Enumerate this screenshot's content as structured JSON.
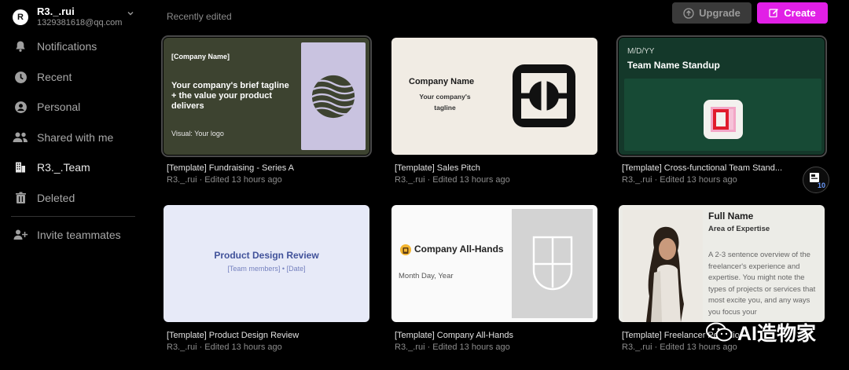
{
  "account": {
    "initial": "R",
    "name": "R3._.rui",
    "email": "1329381618@qq.com"
  },
  "nav": [
    {
      "label": "Notifications",
      "icon": "bell-icon"
    },
    {
      "label": "Recent",
      "icon": "clock-icon"
    },
    {
      "label": "Personal",
      "icon": "user-icon"
    },
    {
      "label": "Shared with me",
      "icon": "people-icon"
    },
    {
      "label": "R3._.Team",
      "icon": "building-icon"
    },
    {
      "label": "Deleted",
      "icon": "trash-icon"
    },
    {
      "label": "Invite teammates",
      "icon": "add-user-icon"
    }
  ],
  "header": {
    "section_label": "Recently edited",
    "upgrade_label": "Upgrade",
    "create_label": "Create"
  },
  "colors": {
    "create_accent": "#e11fe6",
    "upgrade_bg": "#3a3a3a",
    "collab_badge_text": "#6c9cff"
  },
  "cards": [
    {
      "title": "[Template] Fundraising - Series A",
      "meta": "R3._.rui · Edited 13 hours ago",
      "thumb": {
        "company": "[Company Name]",
        "tagline": "Your company's brief tagline + the value your product delivers",
        "visual": "Visual: Your logo"
      }
    },
    {
      "title": "[Template] Sales Pitch",
      "meta": "R3._.rui · Edited 13 hours ago",
      "thumb": {
        "company": "Company Name",
        "tagline": "Your company's tagline"
      }
    },
    {
      "title": "[Template] Cross-functional Team Stand...",
      "meta": "R3._.rui · Edited 13 hours ago",
      "thumb": {
        "date": "M/D/YY",
        "title": "Team Name Standup"
      },
      "collaborators": "10"
    },
    {
      "title": "[Template] Product Design Review",
      "meta": "R3._.rui · Edited 13 hours ago",
      "thumb": {
        "title": "Product Design Review",
        "subtitle": "[Team members] • [Date]"
      }
    },
    {
      "title": "[Template] Company All-Hands",
      "meta": "R3._.rui · Edited 13 hours ago",
      "thumb": {
        "title": "Company All-Hands",
        "date": "Month Day, Year"
      }
    },
    {
      "title": "[Template] Freelancer Portfolio",
      "meta": "R3._.rui · Edited 13 hours ago",
      "thumb": {
        "name": "Full Name",
        "area": "Area of Expertise",
        "description": "A 2-3 sentence overview of the freelancer's experience and expertise. You might note the types of projects or services that most excite you, and any ways you focus your"
      }
    }
  ],
  "watermark": {
    "text": "AI造物家"
  }
}
